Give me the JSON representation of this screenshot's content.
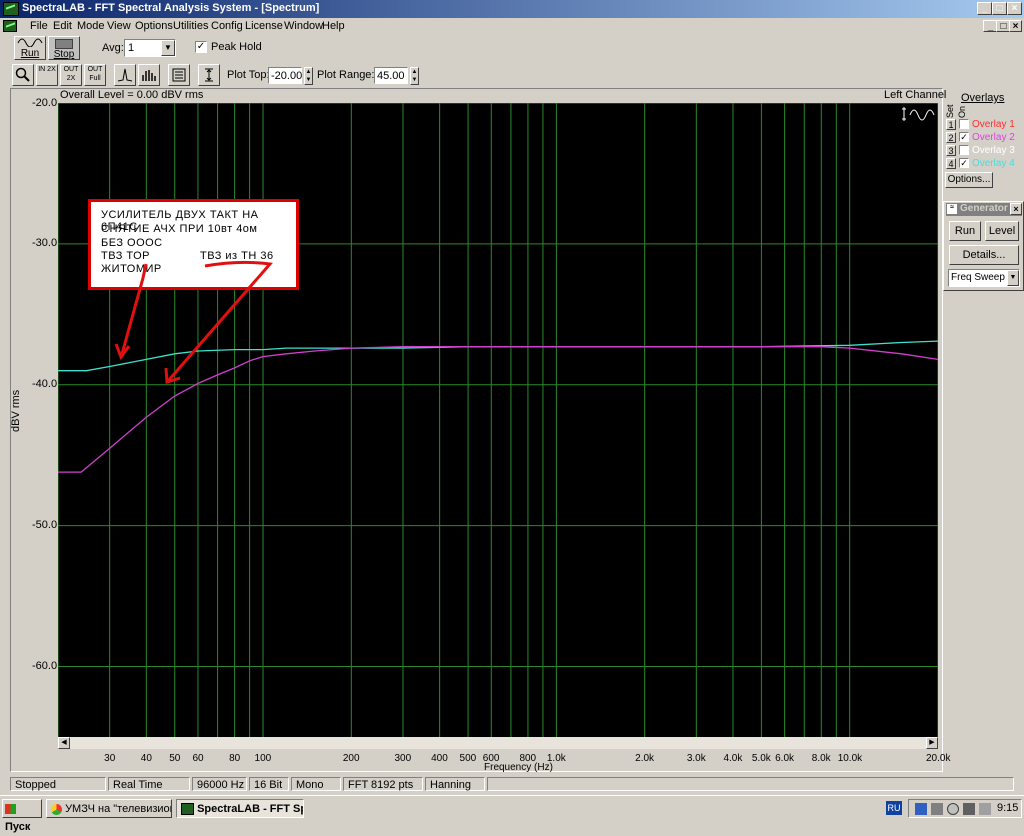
{
  "window": {
    "title": "SpectraLAB - FFT Spectral Analysis System - [Spectrum]"
  },
  "menu": [
    "File",
    "Edit",
    "Mode",
    "View",
    "Options",
    "Utilities",
    "Config",
    "License",
    "Window",
    "Help"
  ],
  "toolbar": {
    "run_label": "Run",
    "stop_label": "Stop",
    "avg_label": "Avg:",
    "avg_value": "1",
    "peak_hold_label": "Peak Hold",
    "peak_hold_checked": true,
    "plot_top_label": "Plot Top:",
    "plot_top_value": "-20.00",
    "plot_range_label": "Plot Range:",
    "plot_range_value": "45.00",
    "zoom_in_label": "IN 2X",
    "zoom_out_label": "OUT 2X",
    "zoom_full_label": "OUT Full"
  },
  "plot": {
    "overall_level": "Overall Level = 0.00 dBV rms",
    "channel": "Left Channel"
  },
  "chart_data": {
    "type": "line",
    "ylabel": "dBV rms",
    "xlabel": "Frequency (Hz)",
    "x_scale": "log",
    "xlim": [
      20,
      20000
    ],
    "ylim": [
      -65,
      -20
    ],
    "grid": true,
    "yticks": [
      "-20.0",
      "-30.0",
      "-40.0",
      "-50.0",
      "-60.0"
    ],
    "ytick_values": [
      -20,
      -30,
      -40,
      -50,
      -60
    ],
    "xticks": [
      "30",
      "40",
      "50",
      "60",
      "80",
      "100",
      "200",
      "300",
      "400",
      "500",
      "600",
      "800",
      "1.0k",
      "2.0k",
      "3.0k",
      "4.0k",
      "5.0k",
      "6.0k",
      "8.0k",
      "10.0k",
      "20.0k"
    ],
    "xtick_values": [
      30,
      40,
      50,
      60,
      80,
      100,
      200,
      300,
      400,
      500,
      600,
      800,
      1000,
      2000,
      3000,
      4000,
      5000,
      6000,
      8000,
      10000,
      20000
    ],
    "series": [
      {
        "name": "Overlay 4",
        "color": "#40e0d0",
        "x": [
          20,
          25,
          30,
          40,
          50,
          60,
          80,
          100,
          120,
          150,
          200,
          300,
          500,
          1000,
          2000,
          5000,
          10000,
          15000,
          20000
        ],
        "y": [
          -39.0,
          -39.0,
          -38.7,
          -38.2,
          -37.8,
          -37.6,
          -37.5,
          -37.5,
          -37.4,
          -37.4,
          -37.4,
          -37.4,
          -37.3,
          -37.3,
          -37.3,
          -37.3,
          -37.2,
          -37.0,
          -36.9
        ]
      },
      {
        "name": "Overlay 2",
        "color": "#d040d0",
        "x": [
          20,
          24,
          30,
          40,
          50,
          60,
          70,
          80,
          90,
          100,
          120,
          150,
          200,
          300,
          500,
          1000,
          2000,
          5000,
          8000,
          10000,
          15000,
          20000
        ],
        "y": [
          -46.2,
          -46.2,
          -44.5,
          -42.3,
          -40.8,
          -39.9,
          -39.3,
          -38.8,
          -38.3,
          -38.0,
          -37.8,
          -37.6,
          -37.4,
          -37.3,
          -37.3,
          -37.3,
          -37.3,
          -37.3,
          -37.3,
          -37.4,
          -37.8,
          -38.2
        ]
      }
    ]
  },
  "annotation": {
    "lines": [
      "УСИЛИТЕЛЬ  ДВУХ  ТАКТ  НА 6П41С",
      "СНЯТИЕ  АЧХ  ПРИ  10вт   4ом",
      "БЕЗ  ОООС",
      "ТВЗ  ТОР",
      "ЖИТОМИР"
    ],
    "right_label": "ТВЗ  из  ТН 36"
  },
  "overlays": {
    "title": "Overlays",
    "col_set": "Set",
    "col_on": "On",
    "items": [
      {
        "num": "1",
        "label": "Overlay 1",
        "checked": false,
        "color": "#ff3030"
      },
      {
        "num": "2",
        "label": "Overlay 2",
        "checked": true,
        "color": "#e040e0"
      },
      {
        "num": "3",
        "label": "Overlay 3",
        "checked": false,
        "color": "#ffffff"
      },
      {
        "num": "4",
        "label": "Overlay 4",
        "checked": true,
        "color": "#40e0e0"
      }
    ],
    "options_label": "Options..."
  },
  "generator": {
    "title": "Generator",
    "run_label": "Run",
    "level_label": "Level",
    "details_label": "Details...",
    "mode_value": "Freq Sweep"
  },
  "status": [
    "Stopped",
    "Real Time",
    "96000 Hz",
    "16 Bit",
    "Mono",
    "FFT 8192 pts",
    "Hanning"
  ],
  "taskbar": {
    "start_label": "Пуск",
    "task1": "УМЗЧ на \"телевизионн...",
    "task2": "SpectraLAB - FFT Spe...",
    "lang": "RU",
    "time": "9:15"
  }
}
